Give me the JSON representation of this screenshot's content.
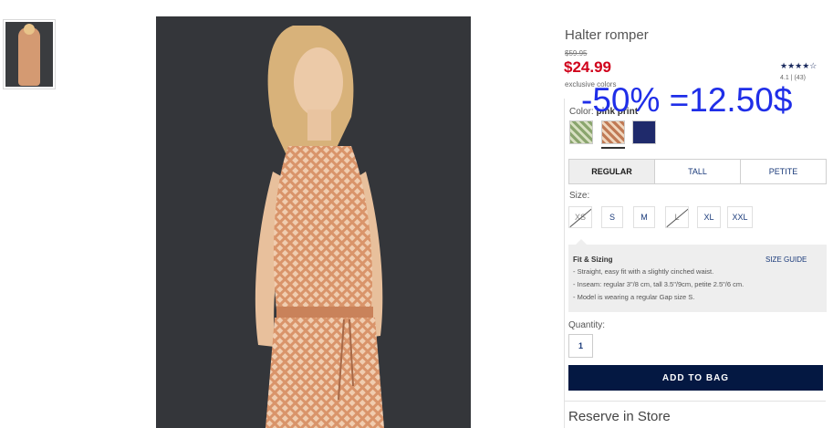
{
  "product": {
    "title": "Halter romper",
    "original_price": "$59.95",
    "price": "$24.99",
    "exclusive_note": "exclusive colors",
    "rating_stars": "★★★★☆",
    "rating_value": "4.1",
    "rating_separator": "|",
    "review_count": "(43)"
  },
  "annotation": "-50% =12.50$",
  "color": {
    "label": "Color:",
    "selected": "pink print"
  },
  "fits": [
    {
      "label": "REGULAR",
      "active": true
    },
    {
      "label": "TALL",
      "active": false
    },
    {
      "label": "PETITE",
      "active": false
    }
  ],
  "size": {
    "label": "Size:",
    "options": [
      {
        "label": "XS",
        "available": false
      },
      {
        "label": "S",
        "available": true
      },
      {
        "label": "M",
        "available": true
      },
      {
        "label": "L",
        "available": false
      },
      {
        "label": "XL",
        "available": true
      },
      {
        "label": "XXL",
        "available": true
      }
    ]
  },
  "fit_sizing": {
    "title": "Fit & Sizing",
    "guide_link": "SIZE GUIDE",
    "bullets": [
      "- Straight, easy fit with a slightly cinched waist.",
      "- Inseam: regular 3\"/8 cm, tall 3.5\"/9cm, petite 2.5\"/6 cm.",
      "- Model is wearing a regular Gap size S."
    ]
  },
  "quantity": {
    "label": "Quantity:",
    "value": "1"
  },
  "add_to_bag": "ADD TO BAG",
  "reserve": "Reserve in Store",
  "colors": {
    "sale": "#d0021b",
    "accent_navy": "#041842",
    "link": "#1a3a7a",
    "annotation": "#1f2ee8"
  }
}
